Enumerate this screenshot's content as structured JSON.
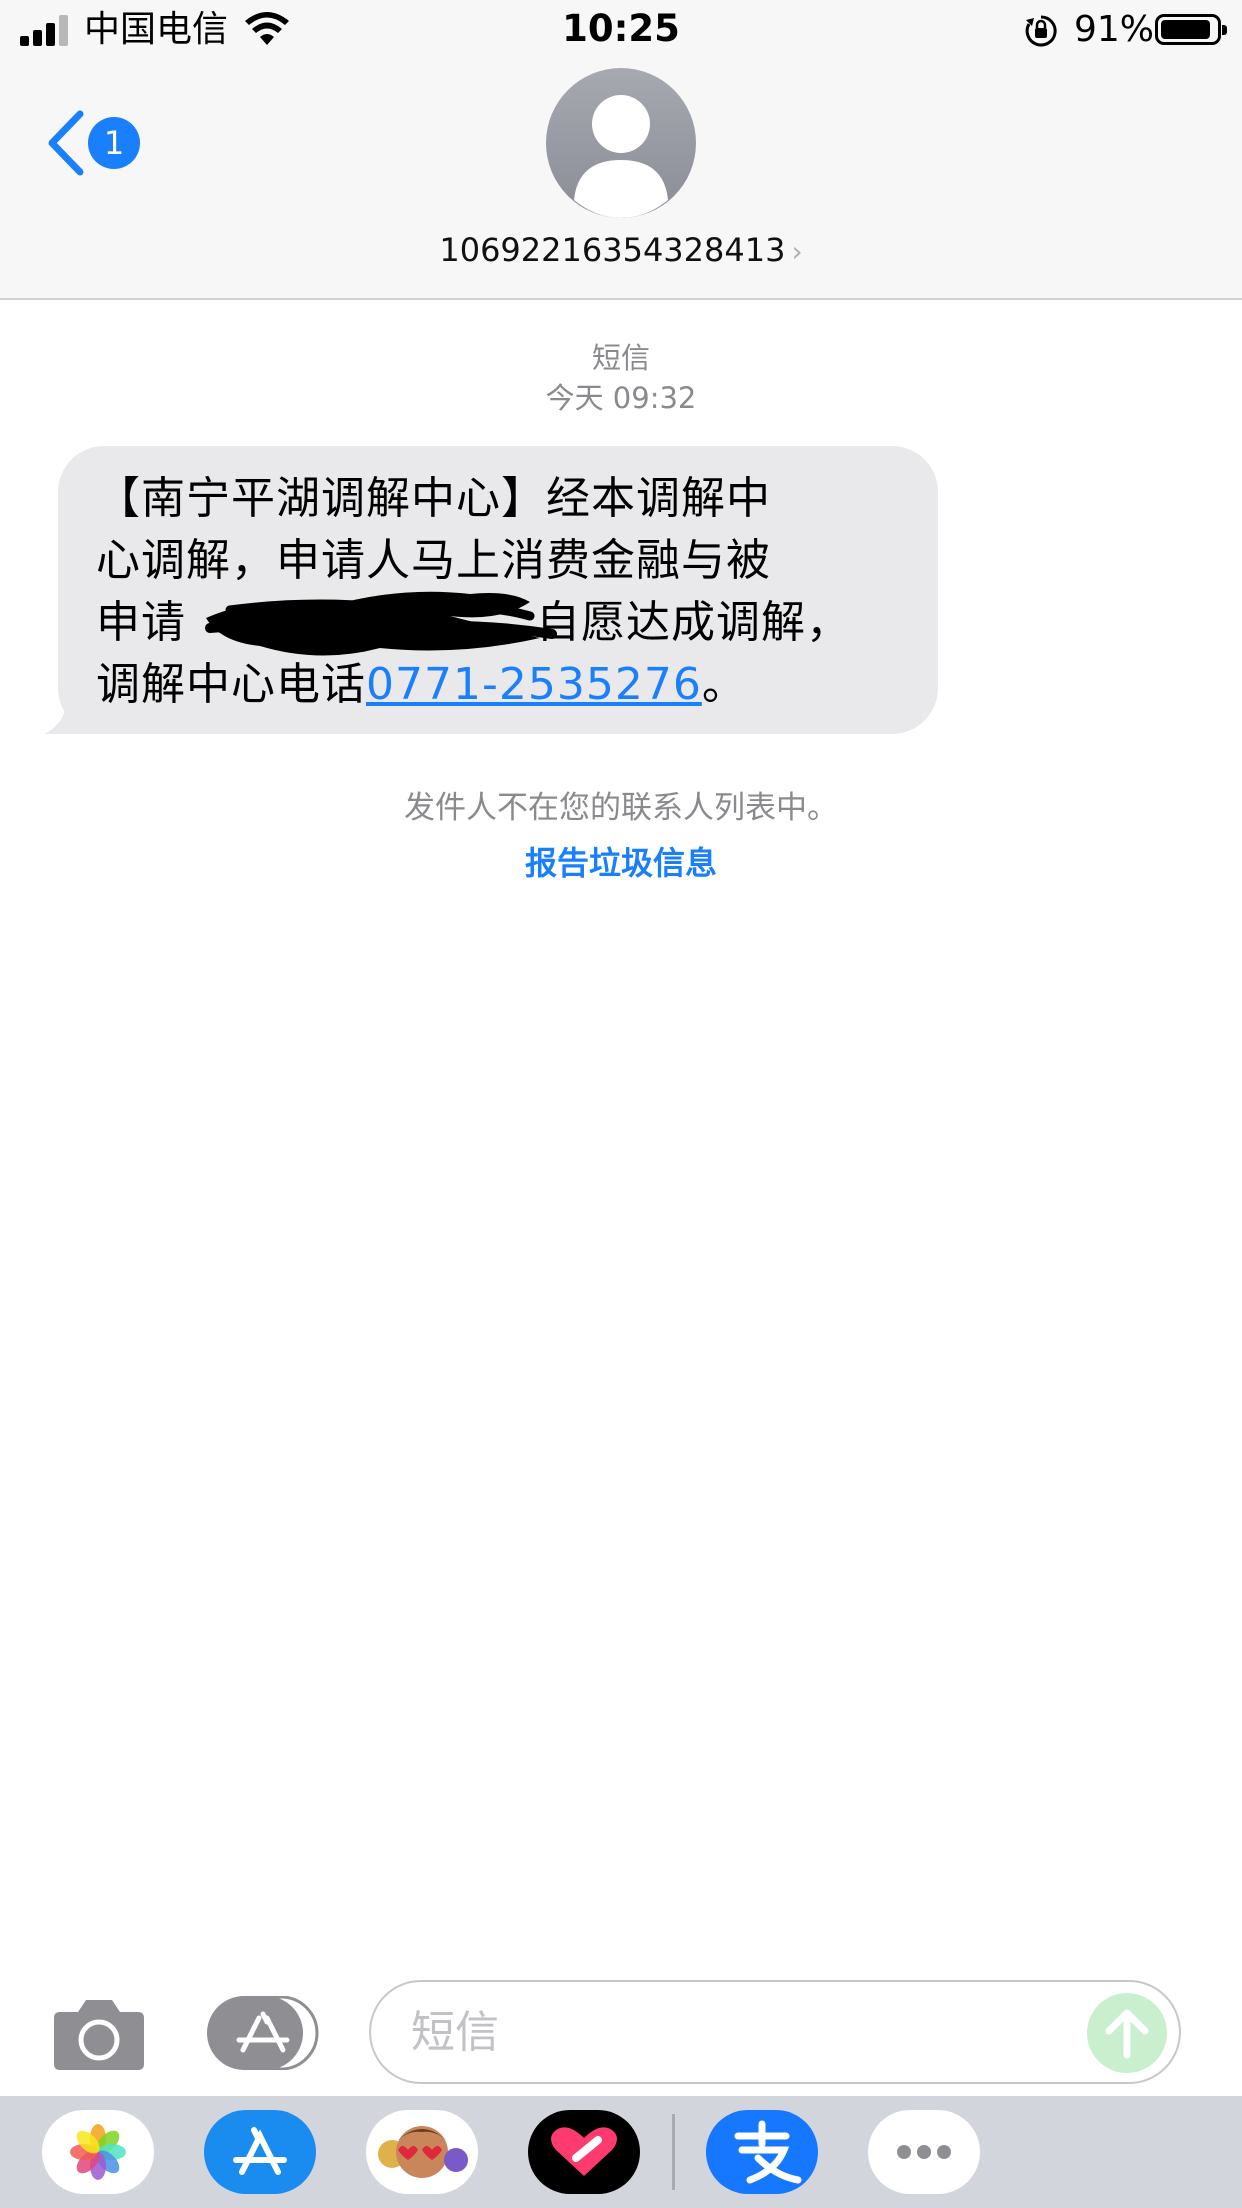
{
  "status_bar": {
    "carrier": "中国电信",
    "time": "10:25",
    "battery_percent": "91%",
    "battery_level": 0.91,
    "signal_bars": 3
  },
  "header": {
    "back_badge": "1",
    "contact_number": "10692216354328413"
  },
  "conversation": {
    "service_label": "短信",
    "timestamp": "今天 09:32",
    "message": {
      "line1": "【南宁平湖调解中心】经本调解中",
      "line2": "心调解，申请人马上消费金融与被",
      "line3_start": "申请",
      "line3_end": "自愿达成调解，",
      "line4_start": "调解中心电话",
      "phone": "0771-2535276",
      "line4_end": "。"
    },
    "not_in_contacts": "发件人不在您的联系人列表中。",
    "report_junk": "报告垃圾信息"
  },
  "compose": {
    "placeholder": "短信"
  },
  "colors": {
    "accent": "#1a7ffa",
    "bubble": "#e9e9eb",
    "meta_text": "#8a8a8e",
    "send_disabled": "#c9efcf"
  },
  "app_drawer": {
    "icons": [
      "photos-icon",
      "app-store-icon",
      "memoji-stickers-icon",
      "digital-touch-icon",
      "alipay-icon",
      "more-icon"
    ]
  }
}
